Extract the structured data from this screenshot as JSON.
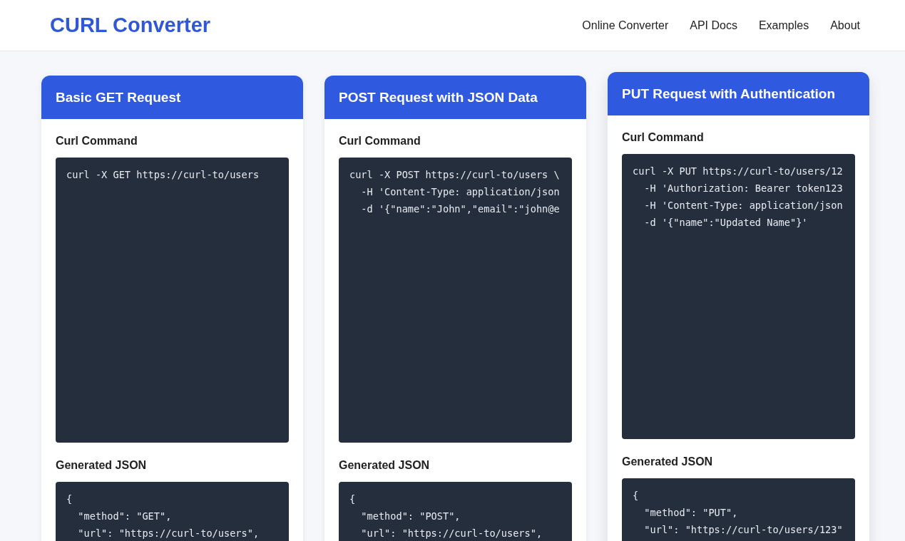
{
  "header": {
    "logo": "CURL Converter",
    "nav": [
      "Online Converter",
      "API Docs",
      "Examples",
      "About"
    ]
  },
  "cards": [
    {
      "title": "Basic GET Request",
      "raised": false,
      "curl_label": "Curl Command",
      "curl": [
        "curl -X GET https://curl-to/users"
      ],
      "json_label": "Generated JSON",
      "json": [
        "{",
        "  \"method\": \"GET\",",
        "  \"url\": \"https://curl-to/users\","
      ]
    },
    {
      "title": "POST Request with JSON Data",
      "raised": false,
      "curl_label": "Curl Command",
      "curl": [
        "curl -X POST https://curl-to/users \\",
        "  -H 'Content-Type: application/json",
        "  -d '{\"name\":\"John\",\"email\":\"john@e"
      ],
      "json_label": "Generated JSON",
      "json": [
        "{",
        "  \"method\": \"POST\",",
        "  \"url\": \"https://curl-to/users\","
      ]
    },
    {
      "title": "PUT Request with Authentication",
      "raised": true,
      "curl_label": "Curl Command",
      "curl": [
        "curl -X PUT https://curl-to/users/12",
        "  -H 'Authorization: Bearer token123",
        "  -H 'Content-Type: application/json",
        "  -d '{\"name\":\"Updated Name\"}'"
      ],
      "json_label": "Generated JSON",
      "json": [
        "{",
        "  \"method\": \"PUT\",",
        "  \"url\": \"https://curl-to/users/123\""
      ]
    }
  ]
}
